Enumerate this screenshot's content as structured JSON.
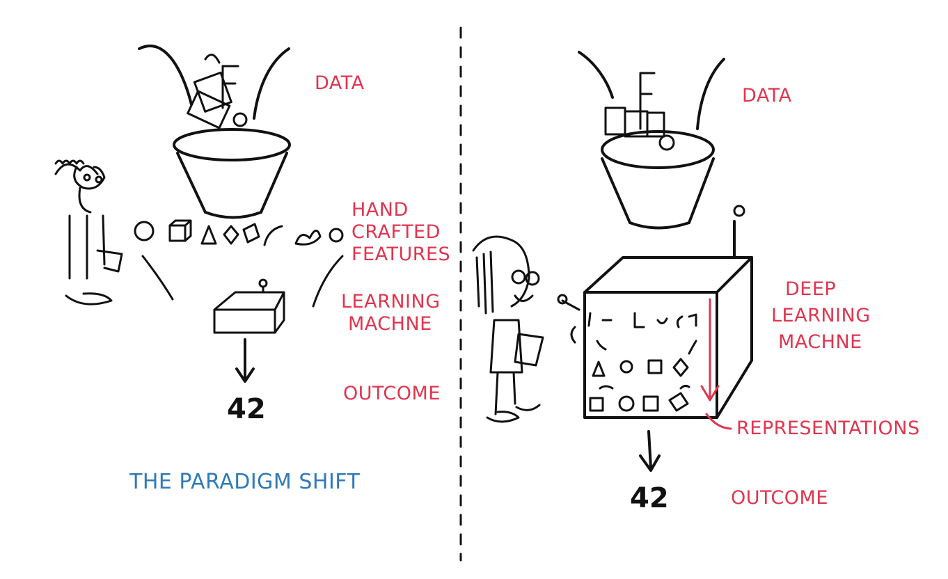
{
  "title": "THE PARADIGM SHIFT",
  "left_panel": {
    "data_label": "DATA",
    "features_label": [
      "HAND",
      "CRAFTED",
      "FEATURES"
    ],
    "machine_label": [
      "LEARNING",
      "MACHNE"
    ],
    "outcome_label": "OUTCOME",
    "outcome_value": "42"
  },
  "right_panel": {
    "data_label": "DATA",
    "machine_label": [
      "DEEP",
      "LEARNING",
      "MACHNE"
    ],
    "representations_label": "REPRESENTATIONS",
    "outcome_label": "OUTCOME",
    "outcome_value": "42"
  },
  "colors": {
    "label_red": "#e0354f",
    "title_blue": "#2f7ab8",
    "ink": "#111111"
  }
}
